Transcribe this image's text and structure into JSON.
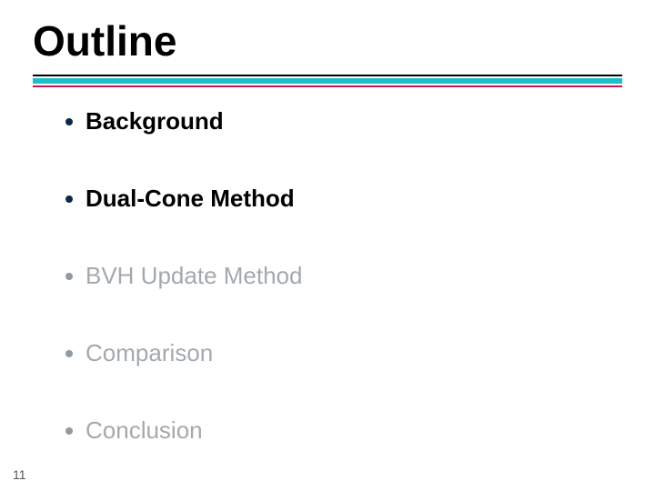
{
  "title": "Outline",
  "items": [
    {
      "label": "Background",
      "active": true
    },
    {
      "label": "Dual-Cone Method",
      "active": true
    },
    {
      "label": "BVH Update Method",
      "active": false
    },
    {
      "label": "Comparison",
      "active": false
    },
    {
      "label": "Conclusion",
      "active": false
    }
  ],
  "page_number": "11",
  "colors": {
    "accent_cyan": "#1bbfca",
    "accent_magenta": "#c2185b"
  }
}
